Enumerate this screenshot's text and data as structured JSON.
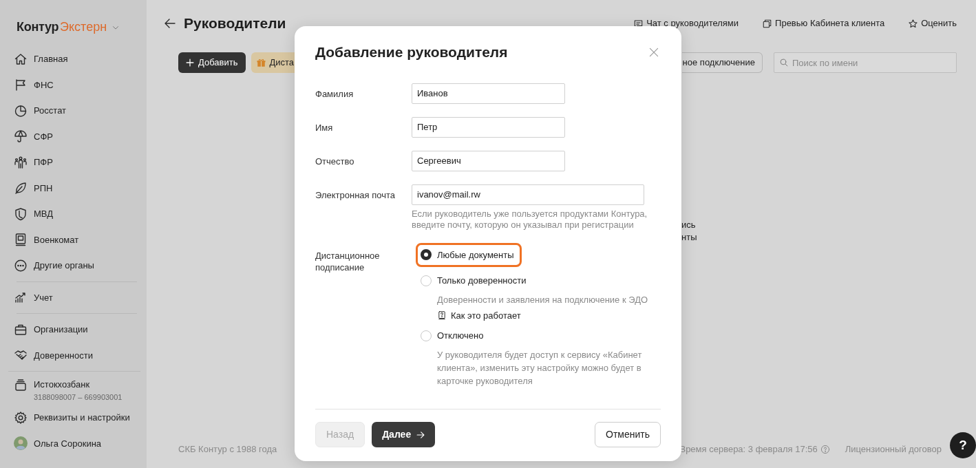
{
  "sidebar": {
    "brand": "Контур",
    "product": "Экстерн",
    "groups": [
      [
        {
          "kind": "link",
          "label": "Главная"
        },
        {
          "kind": "link",
          "label": "ФНС"
        },
        {
          "kind": "link",
          "label": "Росстат"
        },
        {
          "kind": "link",
          "label": "СФР"
        },
        {
          "kind": "link",
          "label": "ПФР"
        },
        {
          "kind": "link",
          "label": "РПН"
        },
        {
          "kind": "link",
          "label": "МВД"
        },
        {
          "kind": "link",
          "label": "Военкомат"
        },
        {
          "kind": "link",
          "label": "Другие органы"
        }
      ],
      [
        {
          "kind": "link",
          "label": "Учет"
        }
      ],
      [
        {
          "kind": "link",
          "label": "Организации"
        },
        {
          "kind": "link",
          "label": "Доверенности"
        }
      ],
      [
        {
          "kind": "org",
          "label": "Истокхозбанк",
          "sublabel": "3188098007 – 669903001"
        },
        {
          "kind": "link",
          "label": "Реквизиты и настройки"
        },
        {
          "kind": "user",
          "label": "Ольга Сорокина"
        }
      ]
    ]
  },
  "page": {
    "title": "Руководители",
    "header_links": [
      {
        "label": "Чат с руководителями"
      },
      {
        "label": "Превью Кабинета клиента"
      },
      {
        "label": "Оценить"
      }
    ],
    "toolbar": {
      "add_button": "Добавить",
      "gift_button": "Диста",
      "partial_button": "ное подключение",
      "search_placeholder": "Поиск по имени"
    },
    "fragments": [
      "ись",
      "нты"
    ],
    "footer": {
      "copyright": "СКБ Контур с 1988 года",
      "server_time": "Время сервера: 3 февраля 17:56",
      "license": "Лицензионный договор",
      "help": "?"
    }
  },
  "modal": {
    "title": "Добавление руководителя",
    "fields": [
      {
        "kind": "text",
        "label": "Фамилия",
        "value": "Иванов"
      },
      {
        "kind": "text",
        "label": "Имя",
        "value": "Петр"
      },
      {
        "kind": "text",
        "label": "Отчество",
        "value": "Сергеевич"
      },
      {
        "kind": "email",
        "label": "Электронная почта",
        "value": "ivanov@mail.rw",
        "hint": "Если руководитель уже пользуется продуктами Контура, введите почту, которую он указывал при регистрации"
      }
    ],
    "signing": {
      "label": "Дистанционное подписание",
      "options": [
        {
          "label": "Любые документы",
          "selected": true,
          "highlighted": true
        },
        {
          "label": "Только доверенности",
          "selected": false,
          "highlighted": false,
          "description": "Доверенности и заявления на подключение к ЭДО",
          "link": "Как это работает"
        },
        {
          "label": "Отключено",
          "selected": false,
          "highlighted": false,
          "description": "У руководителя будет доступ к сервису «Кабинет клиента», изменить эту настройку можно будет в карточке руководителя"
        }
      ]
    },
    "buttons": {
      "back": {
        "label": "Назад",
        "disabled": true
      },
      "next": "Далее",
      "cancel": "Отменить"
    }
  }
}
